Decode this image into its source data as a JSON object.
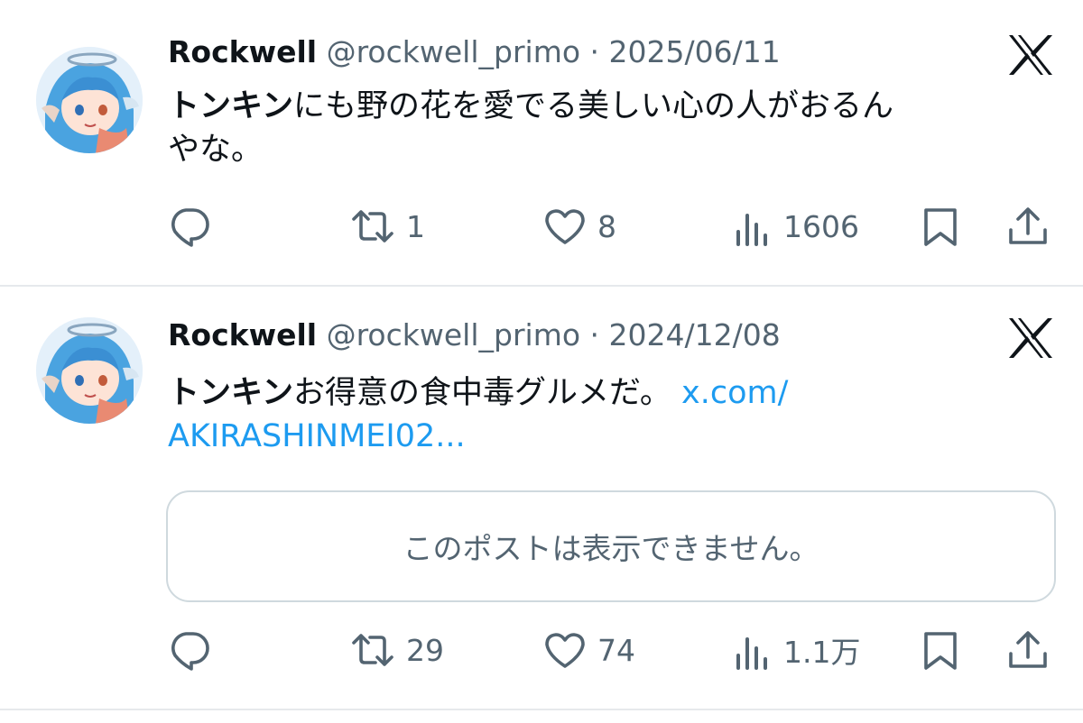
{
  "tweets": [
    {
      "author": "Rockwell",
      "handle": "@rockwell_primo",
      "separator": "·",
      "date": "2025/06/11",
      "text_bold": "トンキン",
      "text_rest": "にも野の花を愛でる美しい心の人がおるん",
      "text_line2": "やな。",
      "replies": "",
      "reposts": "1",
      "likes": "8",
      "views": "1606"
    },
    {
      "author": "Rockwell",
      "handle": "@rockwell_primo",
      "separator": "·",
      "date": "2024/12/08",
      "text_bold": "トンキン",
      "text_rest": "お得意の食中毒グルメだ。",
      "link_part1": "x.com/",
      "link_part2": "AKIRASHINMEI02...",
      "quote_unavailable": "このポストは表示できません。",
      "replies": "",
      "reposts": "29",
      "likes": "74",
      "views": "1.1万"
    }
  ],
  "icons": [
    "reply-icon",
    "repost-icon",
    "like-icon",
    "views-icon",
    "bookmark-icon",
    "share-icon",
    "x-logo-icon"
  ],
  "colors": {
    "text": "#0f1419",
    "secondary": "#536471",
    "link": "#1d9bf0",
    "border": "#cfd9de"
  }
}
